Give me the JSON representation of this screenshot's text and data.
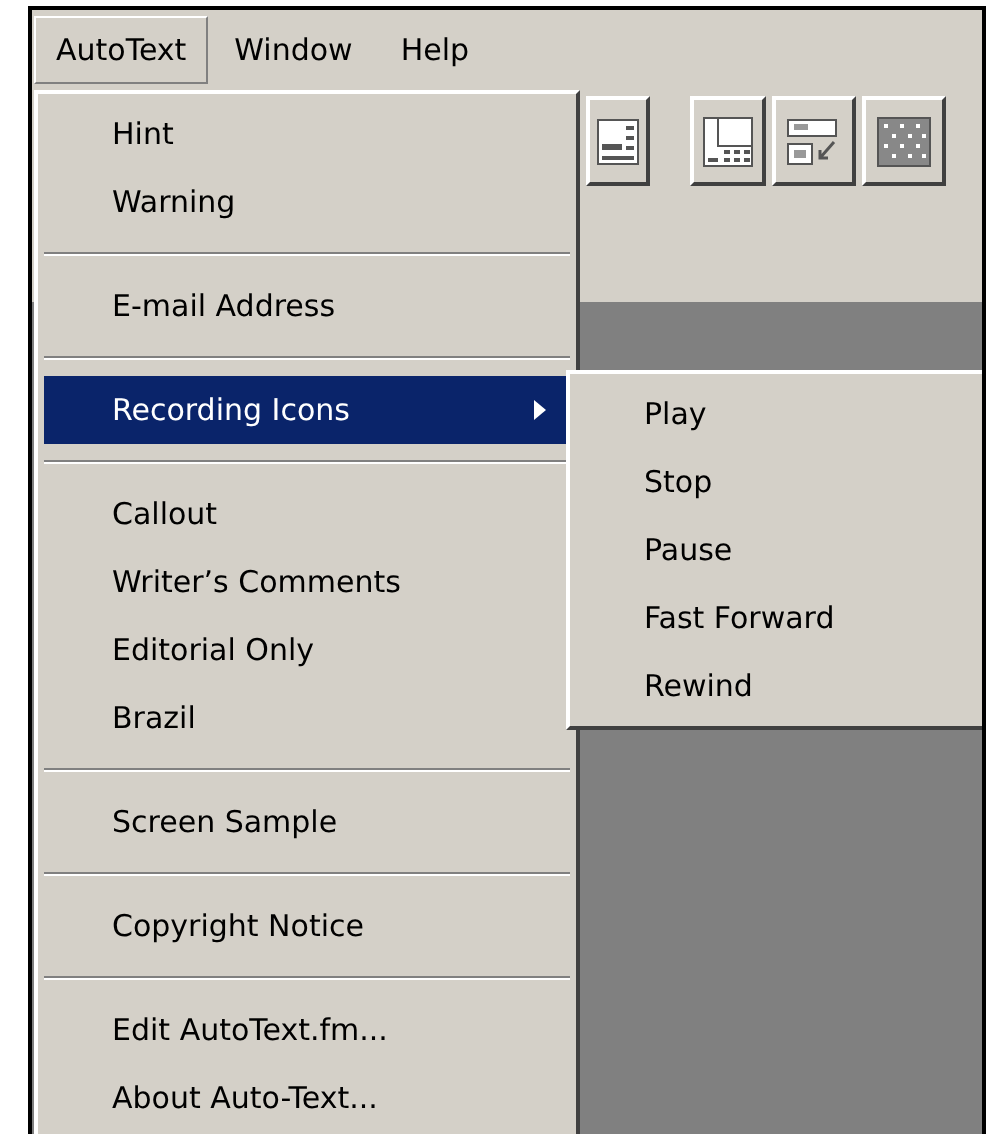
{
  "menubar": [
    {
      "label": "AutoText",
      "selected": true
    },
    {
      "label": "Window",
      "selected": false
    },
    {
      "label": "Help",
      "selected": false
    }
  ],
  "menu": [
    {
      "kind": "item",
      "label": "Hint",
      "selected": false
    },
    {
      "kind": "item",
      "label": "Warning",
      "selected": false
    },
    {
      "kind": "separator"
    },
    {
      "kind": "item",
      "label": "E-mail Address",
      "selected": false
    },
    {
      "kind": "separator"
    },
    {
      "kind": "submenu",
      "label": "Recording Icons",
      "selected": true
    },
    {
      "kind": "separator"
    },
    {
      "kind": "item",
      "label": "Callout",
      "selected": false
    },
    {
      "kind": "item",
      "label": "Writer’s Comments",
      "selected": false
    },
    {
      "kind": "item",
      "label": "Editorial Only",
      "selected": false
    },
    {
      "kind": "item",
      "label": "Brazil",
      "selected": false
    },
    {
      "kind": "separator"
    },
    {
      "kind": "item",
      "label": "Screen Sample",
      "selected": false
    },
    {
      "kind": "separator"
    },
    {
      "kind": "item",
      "label": "Copyright Notice",
      "selected": false
    },
    {
      "kind": "separator"
    },
    {
      "kind": "item",
      "label": "Edit AutoText.fm...",
      "selected": false
    },
    {
      "kind": "item",
      "label": "About Auto-Text...",
      "selected": false
    }
  ],
  "submenu": [
    {
      "label": "Play"
    },
    {
      "label": "Stop"
    },
    {
      "label": "Pause"
    },
    {
      "label": "Fast Forward"
    },
    {
      "label": "Rewind"
    }
  ]
}
